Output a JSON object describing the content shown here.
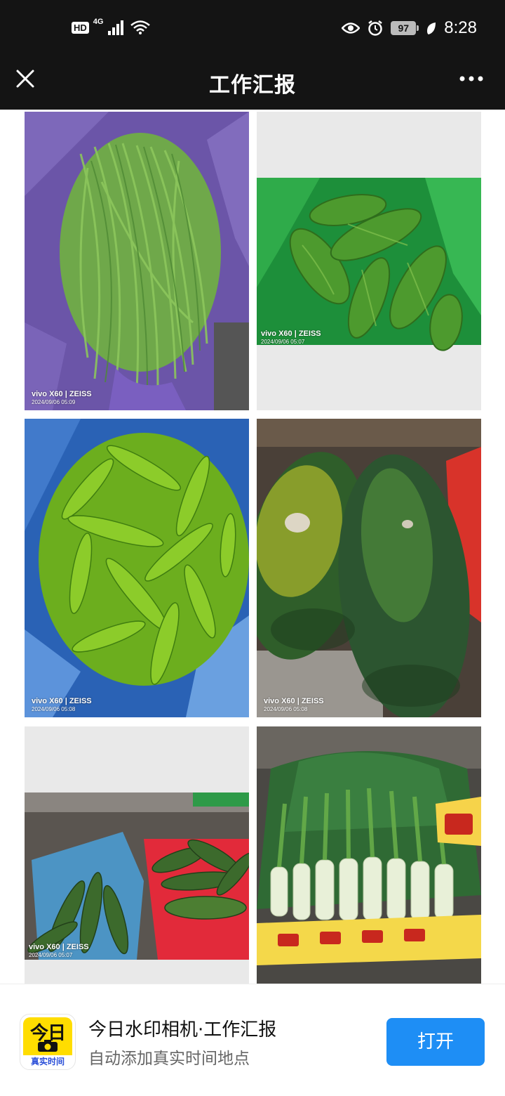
{
  "status_bar": {
    "hd": "HD",
    "network": "4G",
    "battery": "97",
    "time": "8:28",
    "icons": [
      "signal-icon",
      "wifi-icon",
      "eye-icon",
      "alarm-icon",
      "battery-icon",
      "leaf-icon"
    ]
  },
  "nav": {
    "title": "工作汇报",
    "close_icon": "close-icon",
    "more_icon": "more-icon"
  },
  "photos": [
    {
      "subject": "long green beans in purple bag",
      "device": "vivo X60 | ZEISS",
      "timestamp": "2024/09/06 05:09"
    },
    {
      "subject": "bitter melons in green bag",
      "device": "vivo X60 | ZEISS",
      "timestamp": "2024/09/06 05:07"
    },
    {
      "subject": "green peppers in blue bag",
      "device": "vivo X60 | ZEISS",
      "timestamp": "2024/09/06 05:08"
    },
    {
      "subject": "winter melons",
      "device": "vivo X60 | ZEISS",
      "timestamp": "2024/09/06 05:08"
    },
    {
      "subject": "cucumbers in baskets",
      "device": "vivo X60 | ZEISS",
      "timestamp": "2024/09/06 05:07"
    },
    {
      "subject": "green onions bundled",
      "device": "",
      "timestamp": ""
    }
  ],
  "banner": {
    "app_icon_text": "今日",
    "app_icon_label": "真实时间",
    "title": "今日水印相机·工作汇报",
    "subtitle": "自动添加真实时间地点",
    "open_label": "打开"
  },
  "colors": {
    "header_bg": "#141414",
    "accent": "#1e8ef5",
    "app_icon_yellow": "#ffdd00"
  }
}
